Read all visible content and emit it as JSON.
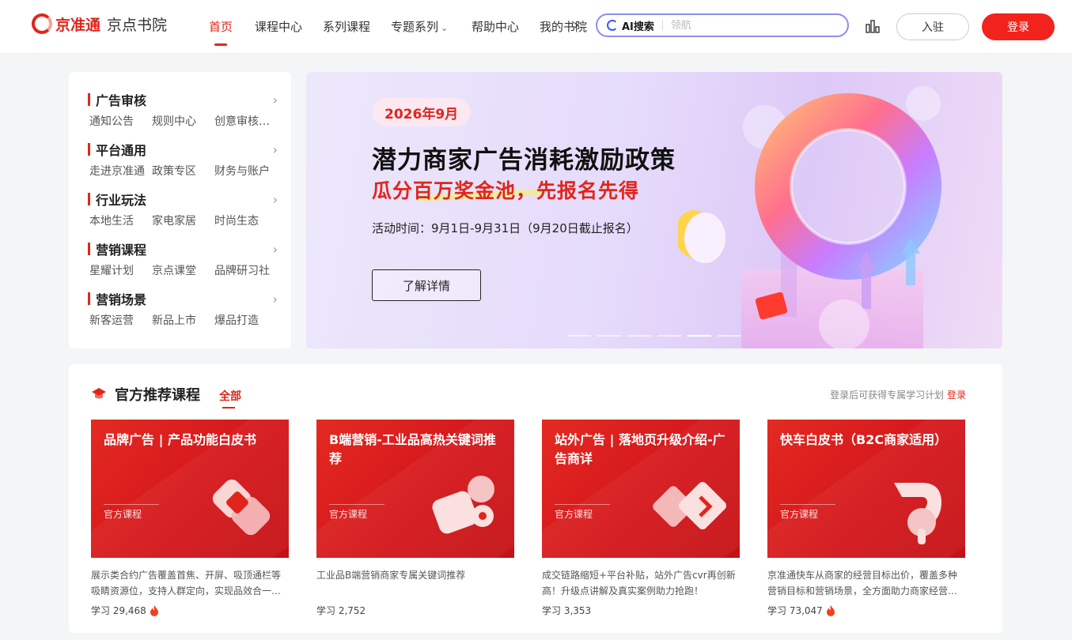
{
  "header": {
    "brand": "京准通",
    "sub_brand": "京点书院",
    "nav": [
      "首页",
      "课程中心",
      "系列课程",
      "专题系列",
      "帮助中心",
      "我的书院"
    ],
    "search_ai_label": "AI搜索",
    "search_placeholder": "领航",
    "join_label": "入驻",
    "login_label": "登录"
  },
  "categories": [
    {
      "title": "广告审核",
      "links": [
        "通知公告",
        "规则中心",
        "创意审核…"
      ]
    },
    {
      "title": "平台通用",
      "links": [
        "走进京准通",
        "政策专区",
        "财务与账户"
      ]
    },
    {
      "title": "行业玩法",
      "links": [
        "本地生活",
        "家电家居",
        "时尚生态"
      ]
    },
    {
      "title": "营销课程",
      "links": [
        "星耀计划",
        "京点课堂",
        "品牌研习社"
      ]
    },
    {
      "title": "营销场景",
      "links": [
        "新客运营",
        "新品上市",
        "爆品打造"
      ]
    }
  ],
  "banner": {
    "date": "2026年9月",
    "title": "潜力商家广告消耗激励政策",
    "subtitle": "瓜分百万奖金池，先报名先得",
    "time": "活动时间：9月1日-9月31日（9月20日截止报名）",
    "button": "了解详情",
    "active_dot": 4,
    "dot_count": 6
  },
  "recommend": {
    "title": "官方推荐课程",
    "tab": "全部",
    "hint": "登录后可获得专属学习计划",
    "hint_login": "登录",
    "courses": [
      {
        "name": "品牌广告 | 产品功能白皮书",
        "tag": "官方课程",
        "desc": "展示类合约广告覆盖首焦、开屏、吸顶通栏等吸睛资源位，支持人群定向，实现品效合一…",
        "stat": "学习 29,468",
        "hot": true
      },
      {
        "name": "B端营销-工业品高热关键词推荐",
        "tag": "官方课程",
        "desc": "工业品B端营销商家专属关键词推荐",
        "stat": "学习 2,752",
        "hot": false
      },
      {
        "name": "站外广告 | 落地页升级介绍-广告商详",
        "tag": "官方课程",
        "desc": "成交链路缩短+平台补贴，站外广告cvr再创新高！升级点讲解及真实案例助力抢跑！",
        "stat": "学习 3,353",
        "hot": false
      },
      {
        "name": "快车白皮书（B2C商家适用）",
        "tag": "官方课程",
        "desc": "京准通快车从商家的经营目标出价，覆盖多种营销目标和营销场景，全方面助力商家经营…",
        "stat": "学习 73,047",
        "hot": true
      }
    ]
  },
  "colors": {
    "accent": "#e1251b",
    "login_bg": "#f2231c",
    "search_border": "#8a8fe8"
  }
}
